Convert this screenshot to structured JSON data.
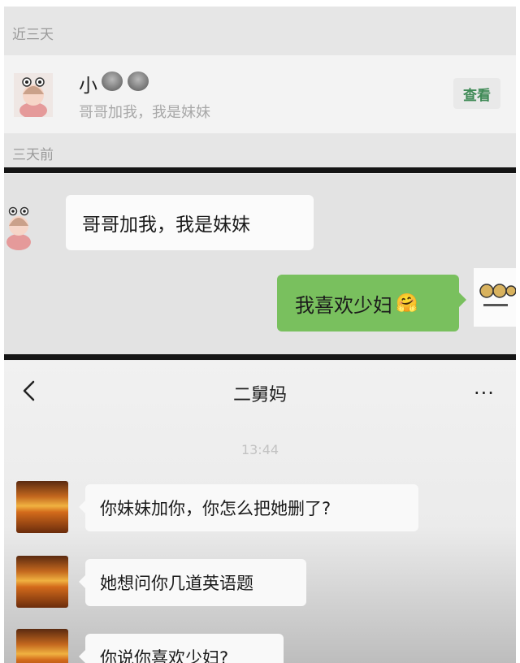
{
  "panel1": {
    "label_recent": "近三天",
    "request": {
      "name": "小",
      "message": "哥哥加我，我是妹妹",
      "view_button": "查看"
    },
    "label_earlier": "三天前"
  },
  "panel2": {
    "incoming": "哥哥加我，我是妹妹",
    "outgoing": "我喜欢少妇",
    "outgoing_emoji": "🤗"
  },
  "panel3": {
    "back_icon": "chevron-left-icon",
    "title": "二舅妈",
    "more_icon": "more-dots-icon",
    "more_glyph": "···",
    "time": "13:44",
    "messages": [
      "你妹妹加你，你怎么把她删了?",
      "她想问你几道英语题",
      "你说你喜欢少妇?"
    ]
  }
}
